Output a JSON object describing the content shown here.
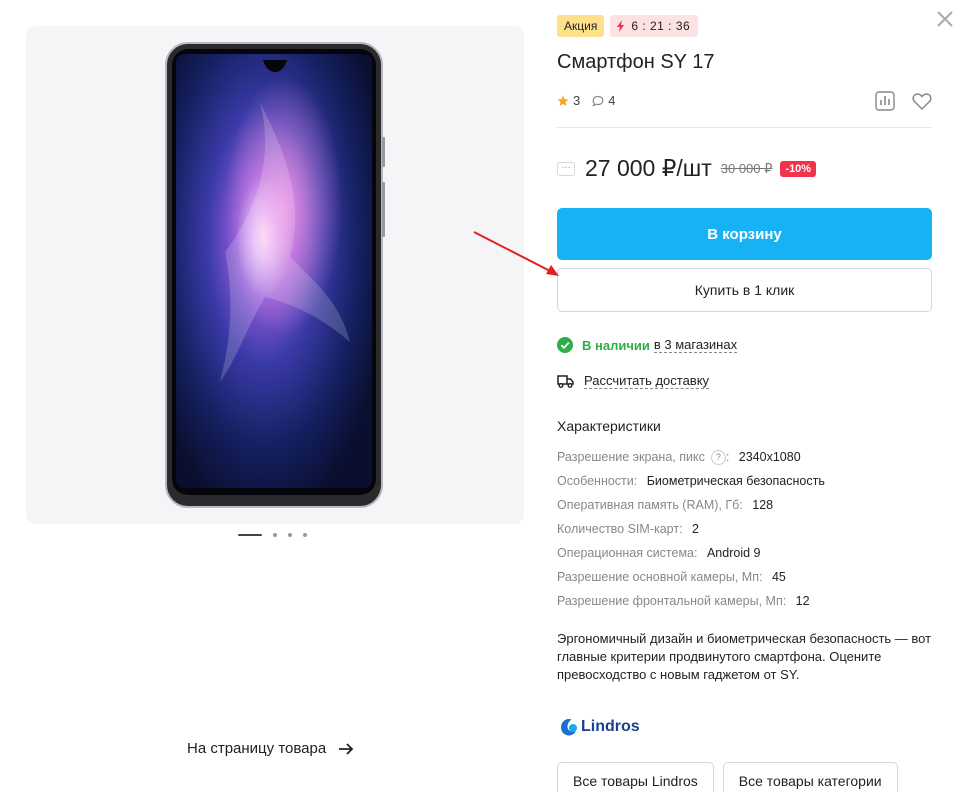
{
  "badges": {
    "sale": "Акция",
    "timer": "6 : 21 : 36"
  },
  "product": {
    "title": "Смартфон SY 17",
    "rating": "3",
    "comments": "4"
  },
  "price": {
    "current": "27 000 ₽/шт",
    "old": "30 000 ₽",
    "discount": "-10%",
    "more": "···"
  },
  "buttons": {
    "cart": "В корзину",
    "one_click": "Купить в 1 клик",
    "to_product": "На страницу товара"
  },
  "availability": {
    "status": "В наличии",
    "stores": "в 3 магазинах",
    "delivery": "Рассчитать доставку"
  },
  "specs": {
    "title": "Характеристики",
    "rows": [
      {
        "key": "Разрешение экрана, пикс",
        "help": "?",
        "value": "2340x1080"
      },
      {
        "key": "Особенности",
        "value": "Биометрическая безопасность"
      },
      {
        "key": "Оперативная память (RAM), Гб",
        "value": "128"
      },
      {
        "key": "Количество SIM-карт",
        "value": "2"
      },
      {
        "key": "Операционная система",
        "value": "Android 9"
      },
      {
        "key": "Разрешение основной камеры, Мп",
        "value": "45"
      },
      {
        "key": "Разрешение фронтальной камеры, Мп",
        "value": "12"
      }
    ]
  },
  "description": "Эргономичный дизайн и биометрическая безопасность — вот главные критерии продвинутого смартфона. Оцените превосходство с новым гаджетом от SY.",
  "brand": {
    "name": "Lindros"
  },
  "chips": [
    "Все товары Lindros",
    "Все товары категории"
  ],
  "colors": {
    "accent": "#16b2f3",
    "in_stock": "#2eae48",
    "discount": "#f2334d",
    "sale_badge": "#fde089",
    "timer_badge": "#fde2e4",
    "annotation": "#e02020"
  },
  "icons": {
    "close": "close-icon",
    "star": "star-icon",
    "comment": "comment-icon",
    "compare": "compare-icon",
    "favorite": "heart-icon",
    "check": "check-circle-icon",
    "truck": "truck-icon",
    "arrow": "arrow-right-icon",
    "bolt": "lightning-icon"
  }
}
